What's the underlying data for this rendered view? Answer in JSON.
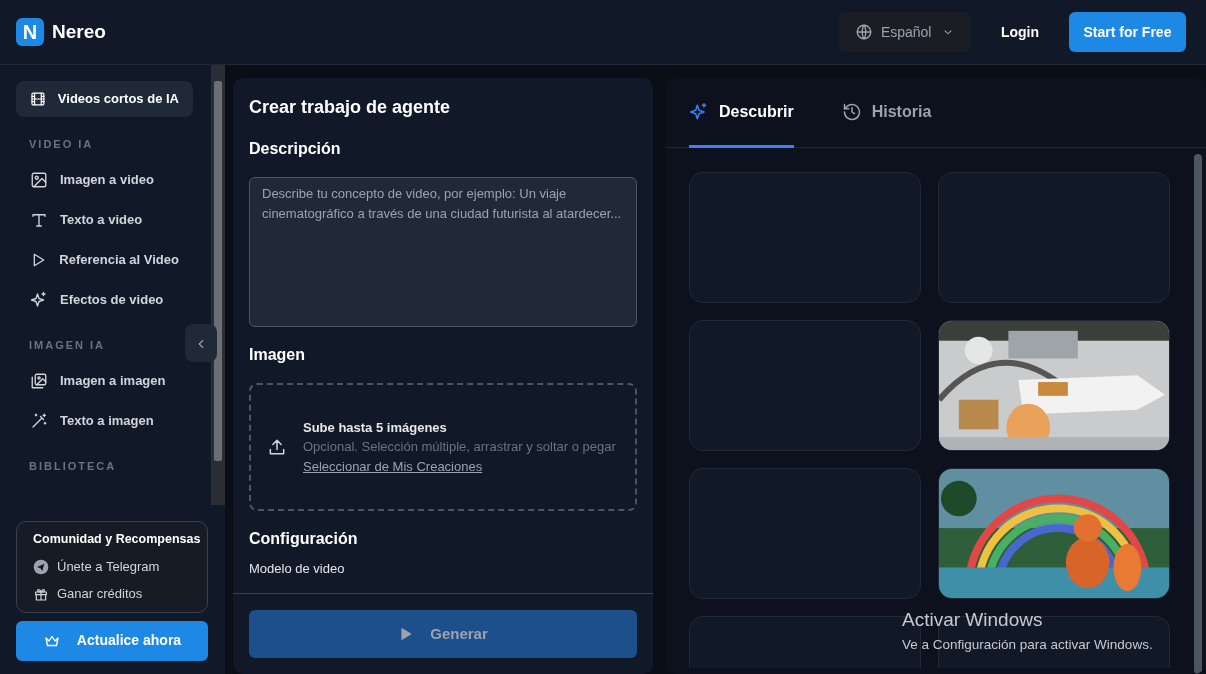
{
  "header": {
    "logo_letter": "N",
    "brand": "Nereo",
    "language": "Español",
    "login": "Login",
    "cta": "Start for Free"
  },
  "sidebar": {
    "items": [
      {
        "kind": "item",
        "label": "Videos cortos de IA",
        "selected": true
      },
      {
        "kind": "section",
        "label": "VIDEO IA"
      },
      {
        "kind": "item",
        "label": "Imagen a video",
        "selected": false
      },
      {
        "kind": "item",
        "label": "Texto a video",
        "selected": false
      },
      {
        "kind": "item",
        "label": "Referencia al Video",
        "selected": false
      },
      {
        "kind": "item",
        "label": "Efectos de video",
        "selected": false
      },
      {
        "kind": "section",
        "label": "IMAGEN IA"
      },
      {
        "kind": "item",
        "label": "Imagen a imagen",
        "selected": false
      },
      {
        "kind": "item",
        "label": "Texto a imagen",
        "selected": false
      },
      {
        "kind": "section",
        "label": "BIBLIOTECA"
      }
    ],
    "community": {
      "title": "Comunidad y Recompensas",
      "links": [
        {
          "label": "Únete a Telegram"
        },
        {
          "label": "Ganar créditos"
        }
      ]
    },
    "upgrade": "Actualice ahora"
  },
  "form": {
    "title": "Crear trabajo de agente",
    "description_label": "Descripción",
    "description": {
      "placeholder": "Describe tu concepto de video, por ejemplo: Un viaje cinematográfico a través de una ciudad futurista al atardecer..."
    },
    "image_label": "Imagen",
    "upload": {
      "title": "Sube hasta 5 imágenes",
      "hint": "Opcional. Selección múltiple, arrastrar y soltar o pegar",
      "link": "Seleccionar de Mis Creaciones"
    },
    "config_label": "Configuración",
    "model_label": "Modelo de video",
    "generate": {
      "label": "Generar",
      "disabled": true
    }
  },
  "tabs": [
    {
      "label": "Descubrir",
      "selected": true
    },
    {
      "label": "Historia",
      "selected": false
    }
  ],
  "gallery": [
    {
      "kind": "empty"
    },
    {
      "kind": "empty"
    },
    {
      "kind": "empty"
    },
    {
      "kind": "picture"
    },
    {
      "kind": "empty"
    },
    {
      "kind": "picture"
    },
    {
      "kind": "empty"
    },
    {
      "kind": "empty"
    }
  ],
  "os_notice": {
    "title": "Activar Windows",
    "text": "Ve a Configuración para activar Windows."
  }
}
